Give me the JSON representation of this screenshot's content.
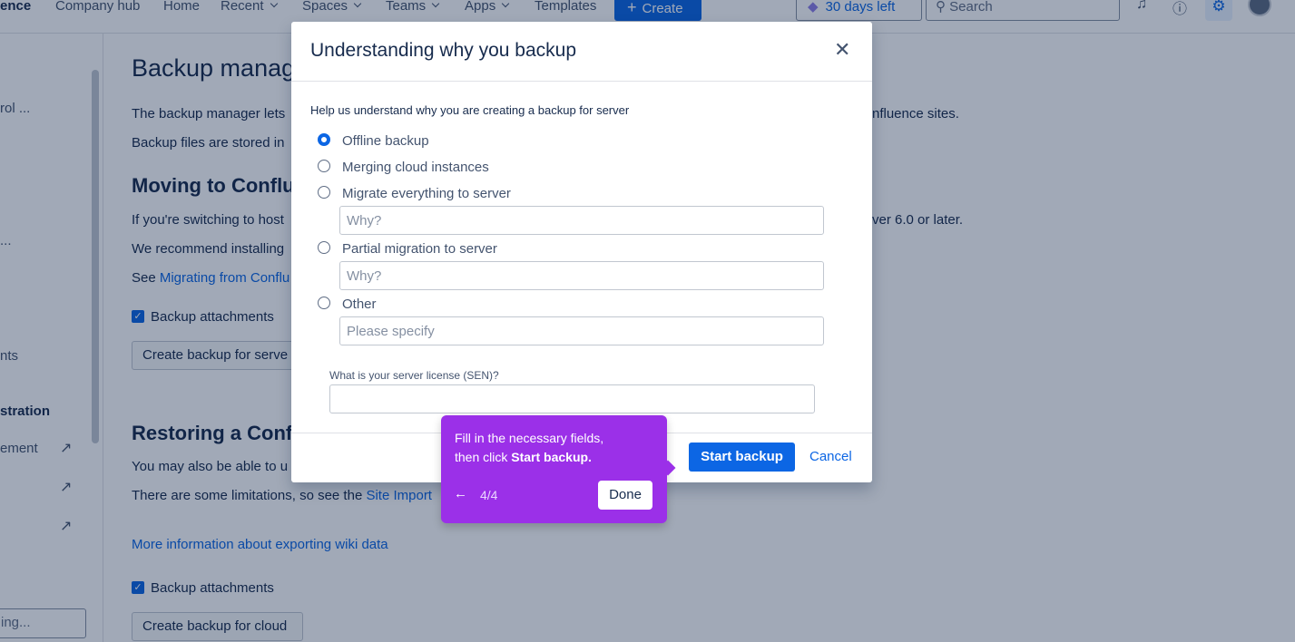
{
  "nav": {
    "brand": "ence",
    "items": [
      "Company hub",
      "Home",
      "Recent",
      "Spaces",
      "Teams",
      "Apps",
      "Templates"
    ],
    "create": "Create",
    "trial": "30 days left",
    "search_placeholder": "Search",
    "icons": [
      "bell-icon",
      "help-icon",
      "gear-icon",
      "avatar"
    ]
  },
  "sidebar": {
    "items": [
      "rol ...",
      "...",
      "nts",
      "stration",
      "ement"
    ],
    "search_value": "ing..."
  },
  "main": {
    "title": "Backup manag",
    "p1": "The backup manager lets",
    "p1_right": "nfluence sites.",
    "p2": "Backup files are stored in",
    "h_moving": "Moving to Conflue",
    "p3": "If you're switching to host",
    "p3_right": "ver 6.0 or later.",
    "p4": "We recommend installing",
    "p5_prefix": "See ",
    "p5_link": "Migrating from Conflu",
    "checkbox1": "Backup attachments",
    "btn_server": "Create backup for serve",
    "h_restoring": "Restoring a Conflu",
    "p6": "You may also be able to u",
    "p7_prefix": "There are some limitations, so see the ",
    "p7_link": "Site Import",
    "more_link": "More information about exporting wiki data",
    "checkbox2": "Backup attachments",
    "btn_cloud": "Create backup for cloud"
  },
  "modal": {
    "title": "Understanding why you backup",
    "help": "Help us understand why you are creating a backup for server",
    "options": [
      {
        "label": "Offline backup",
        "checked": true
      },
      {
        "label": "Merging cloud instances",
        "checked": false
      },
      {
        "label": "Migrate everything to server",
        "checked": false,
        "placeholder": "Why?"
      },
      {
        "label": "Partial migration to server",
        "checked": false,
        "placeholder": "Why?"
      },
      {
        "label": "Other",
        "checked": false,
        "placeholder": "Please specify"
      }
    ],
    "sen_label": "What is your server license (SEN)?",
    "sen_value": "",
    "start": "Start backup",
    "cancel": "Cancel"
  },
  "tour": {
    "line1": "Fill in the necessary fields,",
    "line2_prefix": "then click ",
    "line2_bold": "Start backup.",
    "counter": "4/4",
    "done": "Done"
  }
}
